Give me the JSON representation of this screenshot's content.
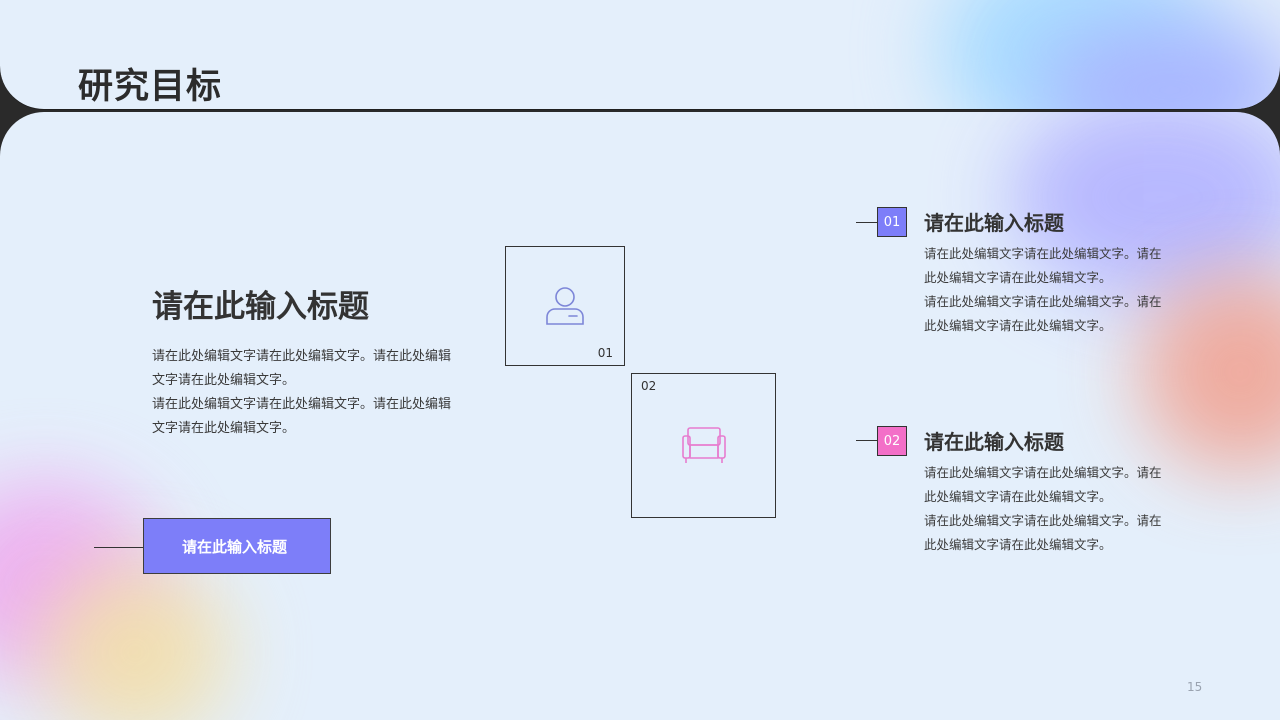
{
  "header": {
    "title": "研究目标"
  },
  "main": {
    "title": "请在此输入标题",
    "paragraphs": [
      "请在此处编辑文字请在此处编辑文字。请在此处编辑文字请在此处编辑文字。",
      "请在此处编辑文字请在此处编辑文字。请在此处编辑文字请在此处编辑文字。"
    ],
    "button_label": "请在此输入标题"
  },
  "features": [
    {
      "number": "01",
      "icon": "user-icon",
      "color": "#7d86d8"
    },
    {
      "number": "02",
      "icon": "sofa-icon",
      "color": "#e77ccf"
    }
  ],
  "items": [
    {
      "number": "01",
      "badge_color": "#7d7ef9",
      "title": "请在此输入标题",
      "paragraphs": [
        "请在此处编辑文字请在此处编辑文字。请在此处编辑文字请在此处编辑文字。",
        "请在此处编辑文字请在此处编辑文字。请在此处编辑文字请在此处编辑文字。"
      ]
    },
    {
      "number": "02",
      "badge_color": "#f36fc8",
      "title": "请在此输入标题",
      "paragraphs": [
        "请在此处编辑文字请在此处编辑文字。请在此处编辑文字请在此处编辑文字。",
        "请在此处编辑文字请在此处编辑文字。请在此处编辑文字请在此处编辑文字。"
      ]
    }
  ],
  "page_number": "15",
  "colors": {
    "background": "#e4effb",
    "accent_purple": "#7d7ef9",
    "accent_pink": "#f36fc8",
    "frame": "#2a2a2a"
  }
}
